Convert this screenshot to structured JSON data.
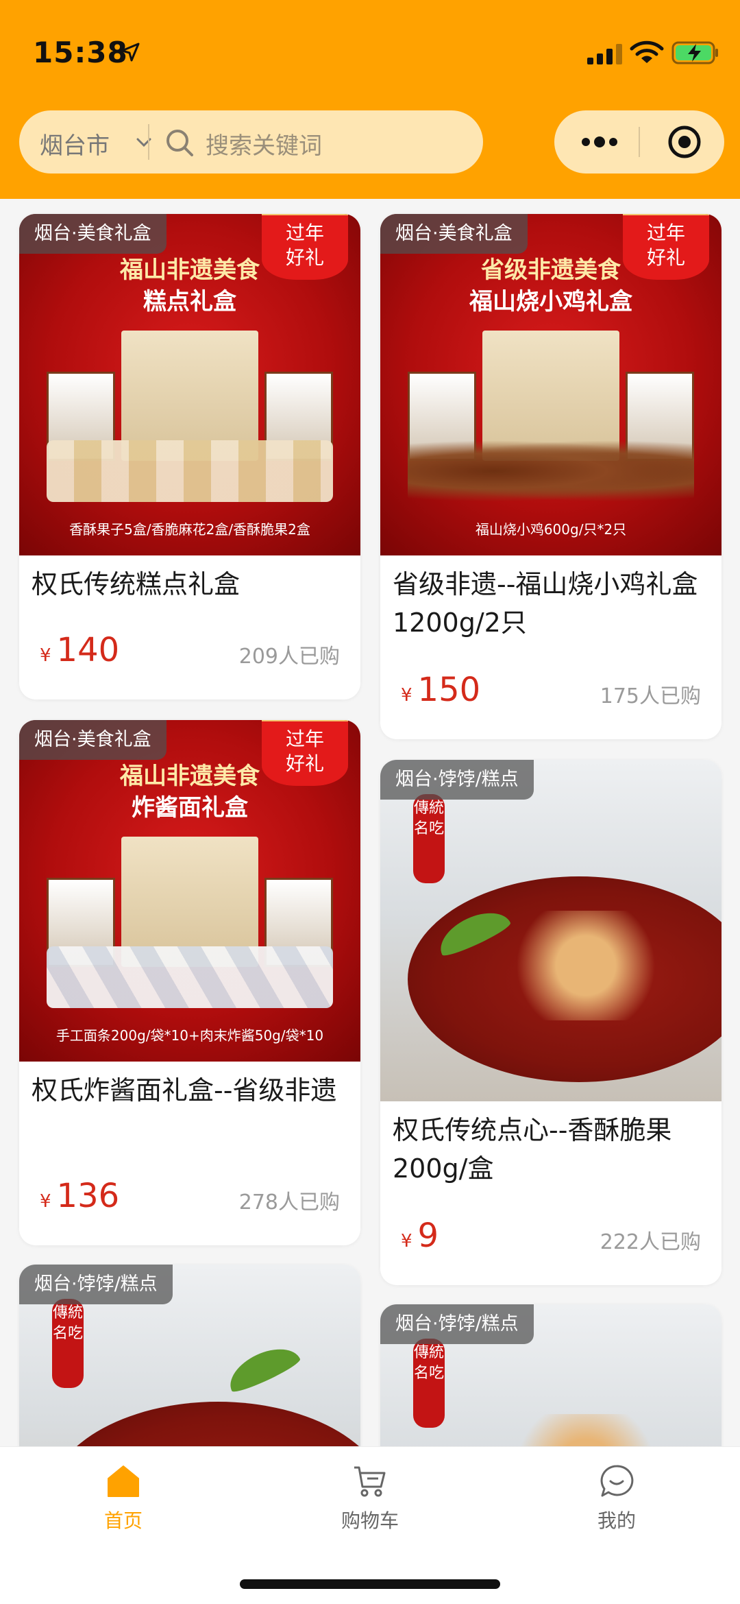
{
  "status_bar": {
    "time": "15:38"
  },
  "header": {
    "city": "烟台市",
    "search_placeholder": "搜索关键词",
    "accent_color": "#FFA200"
  },
  "products": [
    {
      "tag": "烟台·美食礼盒",
      "title": "权氏传统糕点礼盒",
      "currency": "¥",
      "price": "140",
      "sold": "209人已购",
      "image": {
        "badge": [
          "过年",
          "好礼"
        ],
        "banner_line1": "福山非遗美食",
        "banner_line2": "糕点礼盒",
        "caption": "香酥果子5盒/香脆麻花2盒/香酥脆果2盒"
      }
    },
    {
      "tag": "烟台·美食礼盒",
      "title": "省级非遗--福山烧小鸡礼盒1200g/2只",
      "currency": "¥",
      "price": "150",
      "sold": "175人已购",
      "image": {
        "badge": [
          "过年",
          "好礼"
        ],
        "banner_line1": "省级非遗美食",
        "banner_line2": "福山烧小鸡礼盒",
        "caption": "福山烧小鸡600g/只*2只"
      }
    },
    {
      "tag": "烟台·美食礼盒",
      "title": "权氏炸酱面礼盒--省级非遗",
      "currency": "¥",
      "price": "136",
      "sold": "278人已购",
      "image": {
        "badge": [
          "过年",
          "好礼"
        ],
        "banner_line1": "福山非遗美食",
        "banner_line2": "炸酱面礼盒",
        "caption": "手工面条200g/袋*10+肉末炸酱50g/袋*10"
      }
    },
    {
      "tag": "烟台·饽饽/糕点",
      "title": "权氏传统点心--香酥脆果200g/盒",
      "currency": "¥",
      "price": "9",
      "sold": "222人已购",
      "image": {
        "seal": "傳統名吃"
      }
    },
    {
      "tag": "烟台·饽饽/糕点",
      "image": {
        "seal": "傳統名吃"
      }
    },
    {
      "tag": "烟台·饽饽/糕点",
      "image": {
        "seal": "傳統名吃"
      }
    }
  ],
  "tabbar": {
    "items": [
      {
        "label": "首页",
        "icon": "home-icon",
        "active": true
      },
      {
        "label": "购物车",
        "icon": "cart-icon",
        "active": false
      },
      {
        "label": "我的",
        "icon": "chat-icon",
        "active": false
      }
    ]
  }
}
